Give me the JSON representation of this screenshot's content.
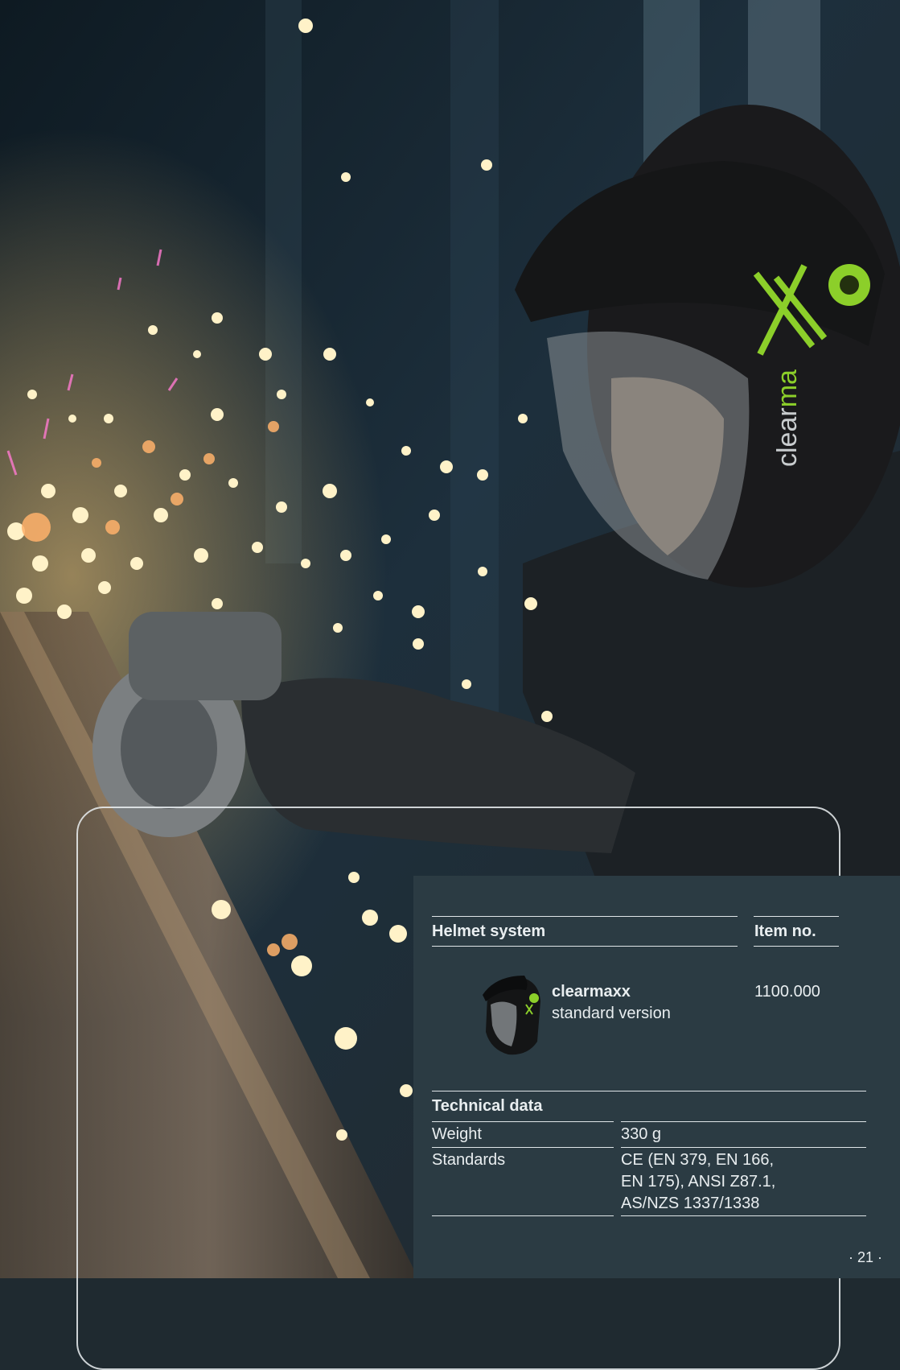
{
  "photo": {
    "helmet_brand_text": "clearmaxx",
    "colors": {
      "helmet_accent": "#8ccf2a",
      "sparks": "#ffe9b0",
      "panel_bg": "#2b3b43"
    }
  },
  "table": {
    "header": {
      "product_col": "Helmet system",
      "item_col": "Item no."
    },
    "product": {
      "name": "clearmaxx",
      "variant": "standard version",
      "item_no": "1100.000",
      "thumbnail_icon": "helmet-icon"
    }
  },
  "tech": {
    "title": "Technical data",
    "rows": [
      {
        "label": "Weight",
        "value": "330 g"
      },
      {
        "label": "Standards",
        "value_lines": [
          "CE (EN 379, EN 166,",
          "EN 175), ANSI Z87.1,",
          "AS/NZS 1337/1338"
        ]
      }
    ]
  },
  "page_number": "· 21 ·"
}
